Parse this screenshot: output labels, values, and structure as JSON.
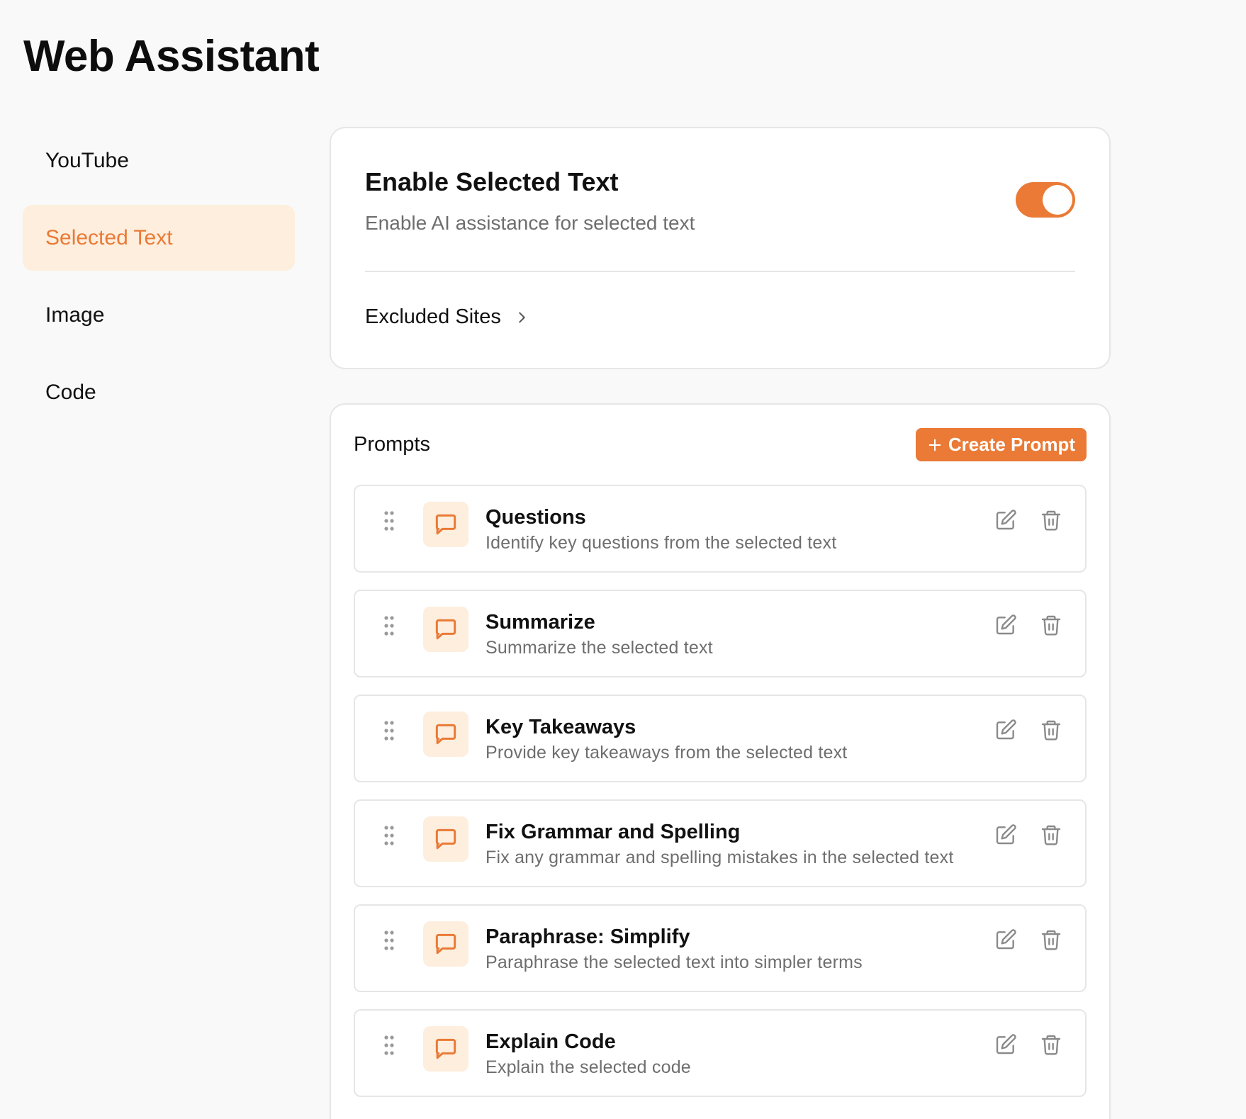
{
  "page_title": "Web Assistant",
  "sidebar": {
    "items": [
      {
        "label": "YouTube",
        "active": false
      },
      {
        "label": "Selected Text",
        "active": true
      },
      {
        "label": "Image",
        "active": false
      },
      {
        "label": "Code",
        "active": false
      }
    ]
  },
  "enable_card": {
    "title": "Enable Selected Text",
    "subtitle": "Enable AI assistance for selected text",
    "toggle_on": true,
    "excluded_label": "Excluded Sites"
  },
  "prompts": {
    "label": "Prompts",
    "create_label": "Create Prompt",
    "items": [
      {
        "title": "Questions",
        "description": "Identify key questions from the selected text"
      },
      {
        "title": "Summarize",
        "description": "Summarize the selected text"
      },
      {
        "title": "Key Takeaways",
        "description": "Provide key takeaways from the selected text"
      },
      {
        "title": "Fix Grammar and Spelling",
        "description": "Fix any grammar and spelling mistakes in the selected text"
      },
      {
        "title": "Paraphrase: Simplify",
        "description": "Paraphrase the selected text into simpler terms"
      },
      {
        "title": "Explain Code",
        "description": "Explain the selected code"
      }
    ]
  },
  "icons": {
    "drag": "drag-handle-icon",
    "bubble": "chat-bubble-icon",
    "edit": "edit-icon",
    "delete": "trash-icon",
    "chevron": "chevron-right-icon",
    "plus": "plus-icon"
  },
  "colors": {
    "accent": "#ea7a36",
    "accent_soft": "#fdeedd",
    "border": "#e6e6e6",
    "muted_text": "#6e6e6e",
    "background": "#f9f9f9"
  }
}
